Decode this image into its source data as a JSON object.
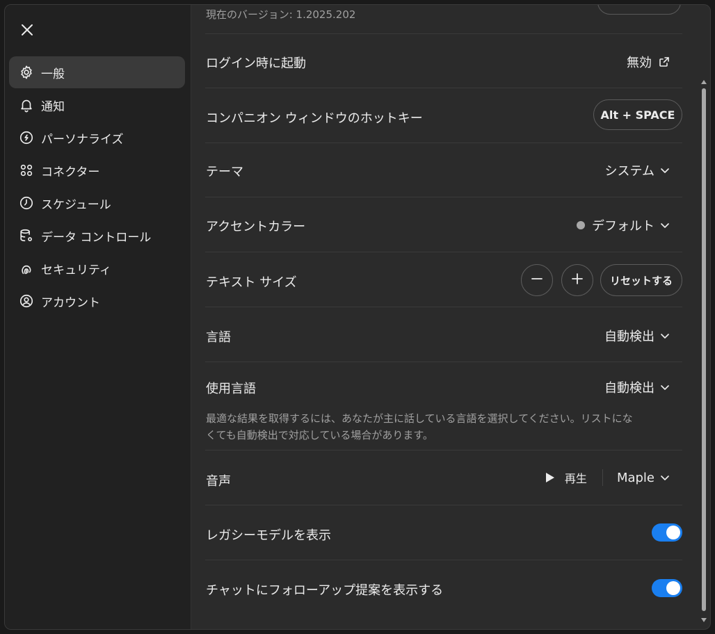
{
  "sidebar": {
    "items": [
      {
        "label": "一般",
        "icon": "gear-icon",
        "active": true
      },
      {
        "label": "通知",
        "icon": "bell-icon",
        "active": false
      },
      {
        "label": "パーソナライズ",
        "icon": "personalize-icon",
        "active": false
      },
      {
        "label": "コネクター",
        "icon": "connectors-icon",
        "active": false
      },
      {
        "label": "スケジュール",
        "icon": "clock-icon",
        "active": false
      },
      {
        "label": "データ コントロール",
        "icon": "database-gear-icon",
        "active": false
      },
      {
        "label": "セキュリティ",
        "icon": "security-icon",
        "active": false
      },
      {
        "label": "アカウント",
        "icon": "account-icon",
        "active": false
      }
    ]
  },
  "settings": {
    "version_text": "現在のバージョン: 1.2025.202",
    "login_start": {
      "label": "ログイン時に起動",
      "value": "無効"
    },
    "hotkey": {
      "label": "コンパニオン ウィンドウのホットキー",
      "value": "Alt + SPACE"
    },
    "theme": {
      "label": "テーマ",
      "value": "システム"
    },
    "accent": {
      "label": "アクセントカラー",
      "value": "デフォルト",
      "dot_color": "#a8a8a8"
    },
    "text_size": {
      "label": "テキスト サイズ",
      "reset": "リセットする"
    },
    "language": {
      "label": "言語",
      "value": "自動検出"
    },
    "spoken_language": {
      "label": "使用言語",
      "value": "自動検出",
      "description": "最適な結果を取得するには、あなたが主に話している言語を選択してください。リストになくても自動検出で対応している場合があります。"
    },
    "voice": {
      "label": "音声",
      "play": "再生",
      "value": "Maple"
    },
    "legacy_models": {
      "label": "レガシーモデルを表示",
      "on": true
    },
    "followup": {
      "label": "チャットにフォローアップ提案を表示する",
      "on": true
    }
  },
  "colors": {
    "toggle_on": "#1a7ff0",
    "background": "#2b2b2b",
    "sidebar": "#212121"
  }
}
